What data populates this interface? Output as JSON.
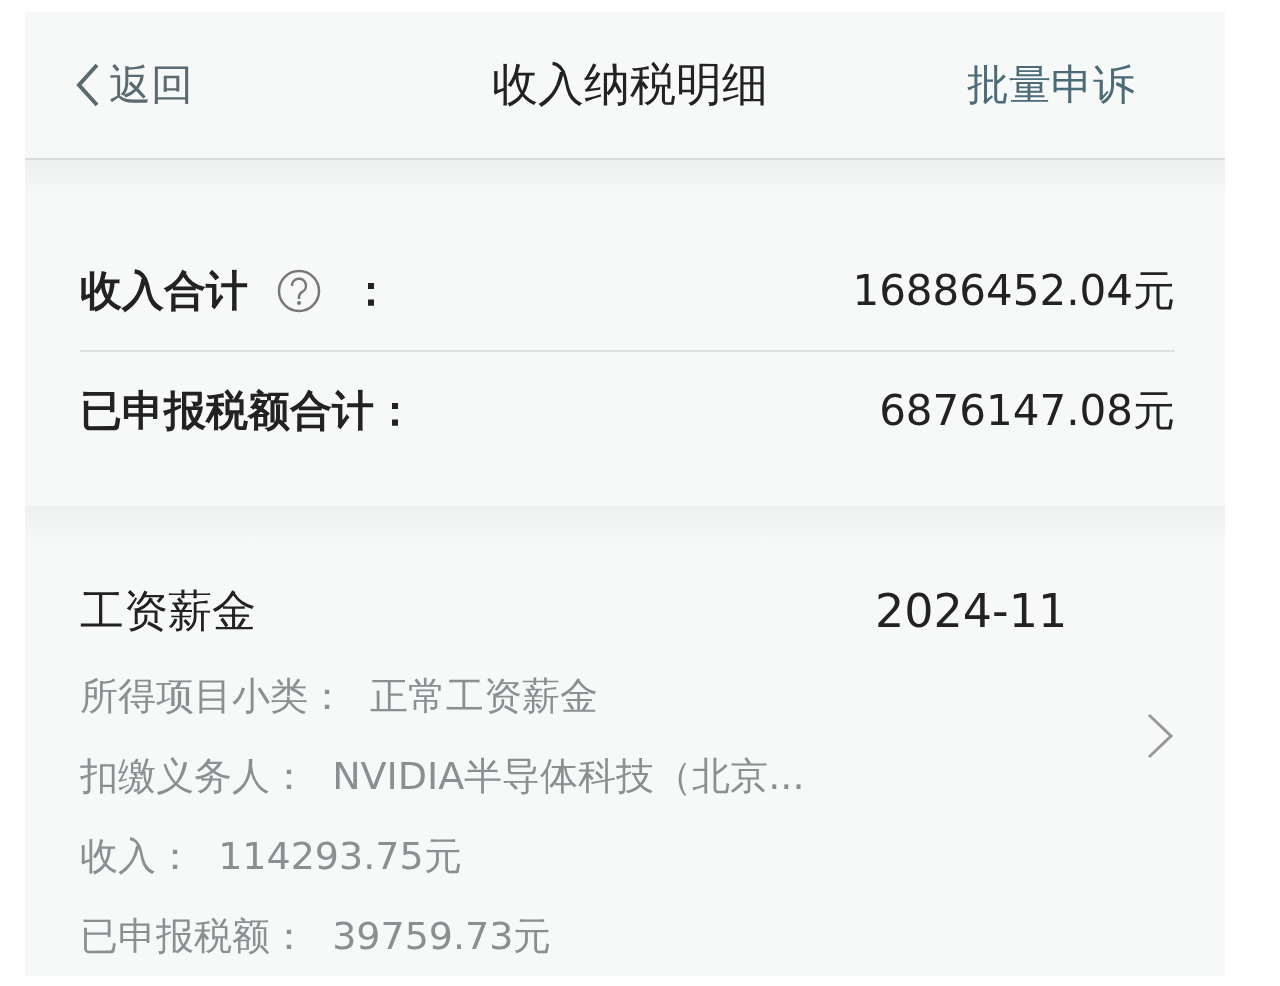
{
  "nav": {
    "back": "返回",
    "title": "收入纳税明细",
    "action": "批量申诉"
  },
  "summary": [
    {
      "label": "收入合计",
      "help": true,
      "colon": "：",
      "value": "16886452.04元"
    },
    {
      "label": "已申报税额合计：",
      "help": false,
      "value": "6876147.08元"
    }
  ],
  "records": [
    {
      "category": "工资薪金",
      "period": "2024-11",
      "has_link": true,
      "lines": [
        {
          "text": "所得项目小类：  正常工资薪金"
        },
        {
          "text": "扣缴义务人：  NVIDIA半导体科技（北京..."
        },
        {
          "text": "收入：  114293.75元"
        },
        {
          "text": "已申报税额：  39759.73元"
        }
      ]
    }
  ]
}
